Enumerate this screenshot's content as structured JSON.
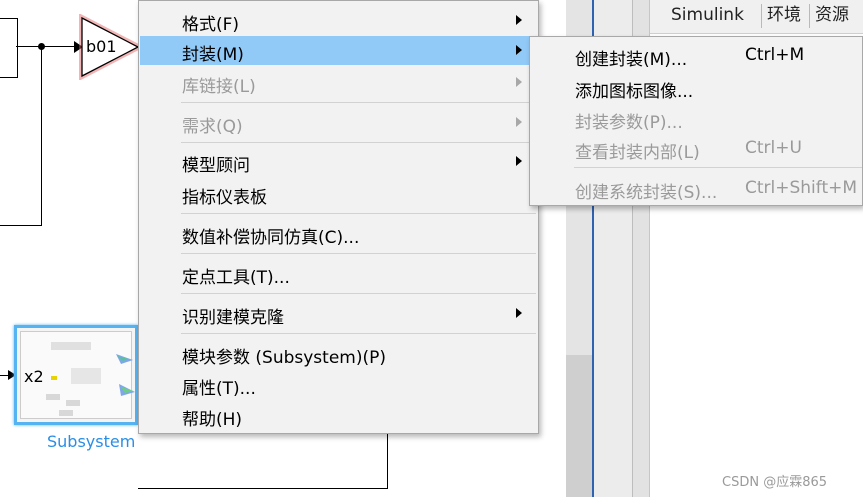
{
  "diagram": {
    "gain_block_label": "b01",
    "subsystem_input_label": "x2",
    "subsystem_label": "Subsystem"
  },
  "right_panel": {
    "tabs": [
      "Simulink",
      "环境",
      "资源"
    ]
  },
  "context_menu": {
    "items": [
      {
        "label": "格式(F)",
        "enabled": true,
        "submenu": true
      },
      {
        "label": "封装(M)",
        "enabled": true,
        "submenu": true,
        "highlighted": true
      },
      {
        "label": "库链接(L)",
        "enabled": false,
        "submenu": true
      },
      {
        "label": "需求(Q)",
        "enabled": false,
        "submenu": true
      },
      {
        "label": "模型顾问",
        "enabled": true,
        "submenu": true
      },
      {
        "label": "指标仪表板",
        "enabled": true,
        "submenu": false
      },
      {
        "label": "数值补偿协同仿真(C)...",
        "enabled": true,
        "submenu": false
      },
      {
        "label": "定点工具(T)...",
        "enabled": true,
        "submenu": false
      },
      {
        "label": "识别建模克隆",
        "enabled": true,
        "submenu": true
      },
      {
        "label": "模块参数 (Subsystem)(P)",
        "enabled": true,
        "submenu": false
      },
      {
        "label": "属性(T)...",
        "enabled": true,
        "submenu": false
      },
      {
        "label": "帮助(H)",
        "enabled": true,
        "submenu": false
      }
    ]
  },
  "mask_submenu": {
    "items": [
      {
        "label": "创建封装(M)...",
        "shortcut": "Ctrl+M",
        "enabled": true
      },
      {
        "label": "添加图标图像...",
        "shortcut": "",
        "enabled": true
      },
      {
        "label": "封装参数(P)...",
        "shortcut": "",
        "enabled": false
      },
      {
        "label": "查看封装内部(L)",
        "shortcut": "Ctrl+U",
        "enabled": false
      },
      {
        "label": "创建系统封装(S)...",
        "shortcut": "Ctrl+Shift+M",
        "enabled": false
      }
    ]
  },
  "watermark": "CSDN @应霖865",
  "colors": {
    "highlight": "#91c9f7",
    "subsystem_border": "#54b3f0",
    "subsystem_label": "#2a8ee6",
    "gain_glow": "#e35b5b"
  }
}
